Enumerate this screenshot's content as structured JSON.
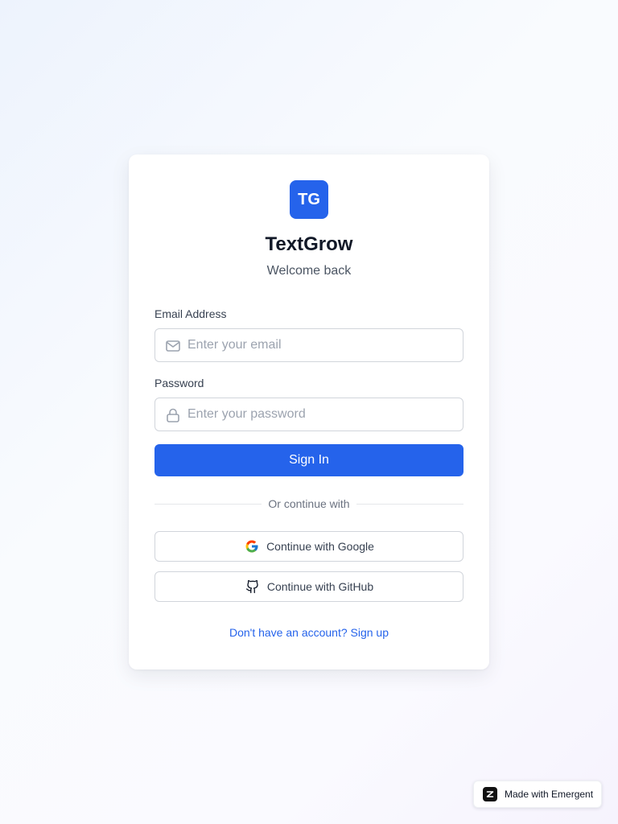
{
  "brand": {
    "logo_text": "TG",
    "name": "TextGrow",
    "tagline": "Welcome back",
    "accent_color": "#2563eb"
  },
  "form": {
    "email": {
      "label": "Email Address",
      "placeholder": "Enter your email",
      "value": "",
      "icon": "mail-icon"
    },
    "password": {
      "label": "Password",
      "placeholder": "Enter your password",
      "value": "",
      "icon": "lock-icon"
    },
    "submit_label": "Sign In"
  },
  "divider": {
    "text": "Or continue with"
  },
  "social": {
    "google_label": "Continue with Google",
    "github_label": "Continue with GitHub"
  },
  "footer": {
    "signup_text": "Don't have an account? Sign up"
  },
  "badge": {
    "text": "Made with Emergent"
  }
}
